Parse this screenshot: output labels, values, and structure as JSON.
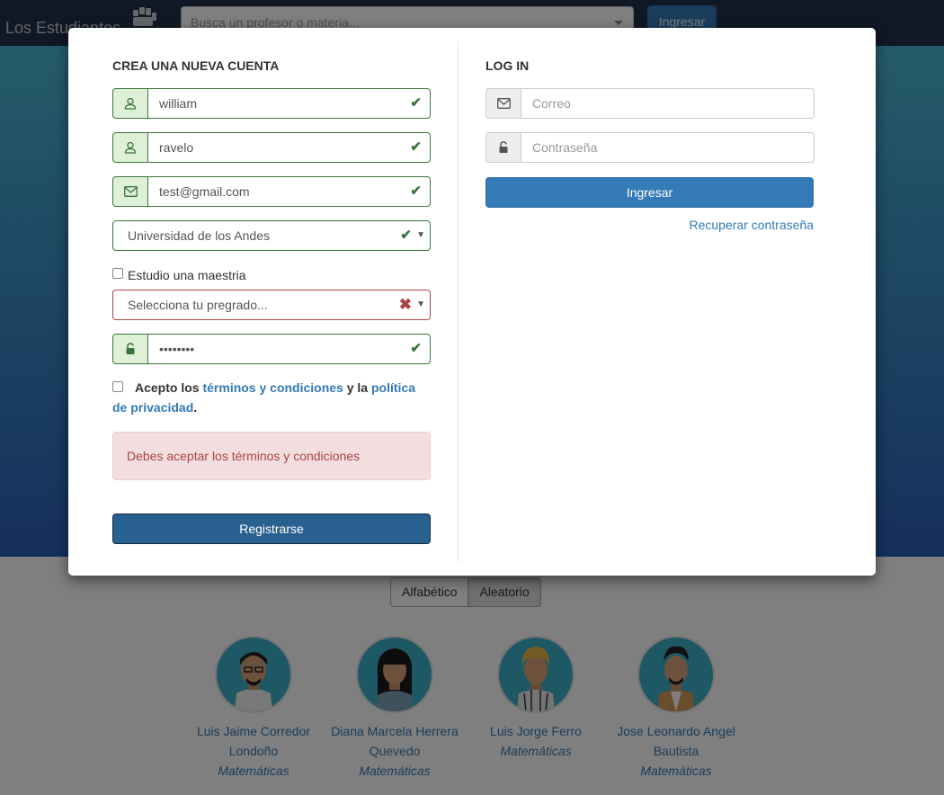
{
  "navbar": {
    "brand": "Los Estudiantes",
    "search_placeholder": "Busca un profesor o materia...",
    "login_label": "Ingresar"
  },
  "sort": {
    "alphabetic": "Alfabético",
    "random": "Aleatorio"
  },
  "professors": [
    {
      "name": "Luis Jaime Corredor Londoño",
      "department": "Matemáticas"
    },
    {
      "name": "Diana Marcela Herrera Quevedo",
      "department": "Matemáticas"
    },
    {
      "name": "Luis Jorge Ferro",
      "department": "Matemáticas"
    },
    {
      "name": "Jose Leonardo Angel Bautista",
      "department": "Matemáticas"
    }
  ],
  "register": {
    "title": "CREA UNA NUEVA CUENTA",
    "first_name": "william",
    "last_name": "ravelo",
    "email": "test@gmail.com",
    "university": "Universidad de los Andes",
    "masters_label": "Estudio una maestria",
    "program_placeholder": "Selecciona tu pregrado...",
    "password_mask": "••••••••",
    "terms_prefix": "Acepto los ",
    "terms_link": "términos y condiciones",
    "terms_middle": " y la ",
    "privacy_link": "política de privacidad",
    "terms_suffix": ".",
    "error_message": "Debes aceptar los términos y condiciones",
    "submit_label": "Registrarse"
  },
  "login": {
    "title": "LOG IN",
    "email_placeholder": "Correo",
    "password_placeholder": "Contraseña",
    "submit_label": "Ingresar",
    "recover_label": "Recuperar contraseña"
  },
  "colors": {
    "success": "#3c763d",
    "error": "#a94442",
    "primary": "#337ab7"
  }
}
